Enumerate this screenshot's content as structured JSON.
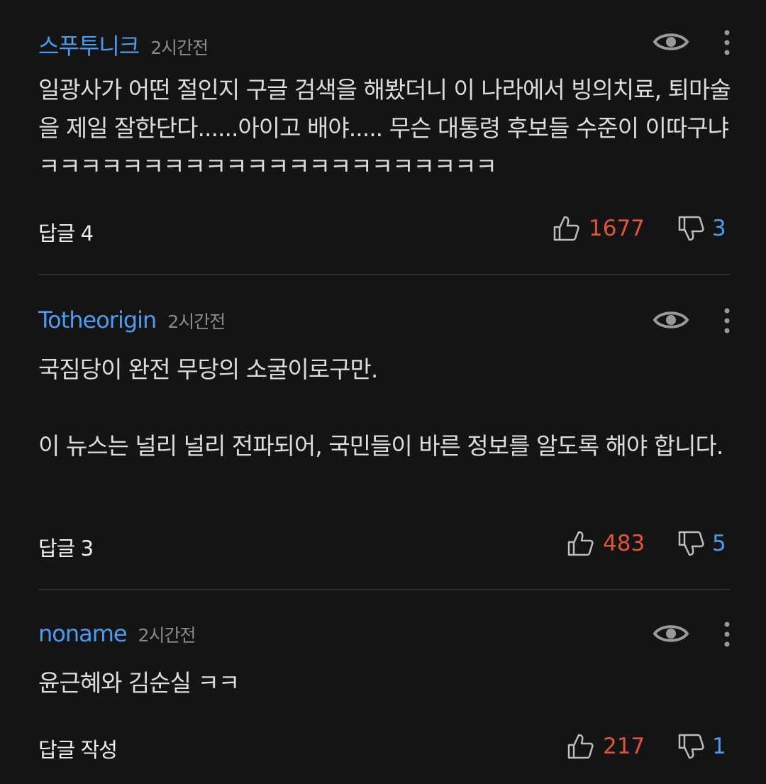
{
  "comments": [
    {
      "username": "스푸투니크",
      "time": "2시간전",
      "text": "일광사가 어떤 절인지 구글 검색을 해봤더니 이 나라에서 빙의치료, 퇴마술을 제일 잘한단다......아이고 배야..... 무슨 대통령 후보들 수준이 이따구냐 ㅋㅋㅋㅋㅋㅋㅋㅋㅋㅋㅋㅋㅋㅋㅋㅋㅋㅋㅋㅋㅋㅋ",
      "replies": "답글 4",
      "likes": "1677",
      "dislikes": "3"
    },
    {
      "username": "Totheorigin",
      "time": "2시간전",
      "text": "국짐당이 완전 무당의 소굴이로구만.\n\n이 뉴스는 널리 널리 전파되어, 국민들이 바른 정보를 알도록 해야 합니다.",
      "replies": "답글 3",
      "likes": "483",
      "dislikes": "5"
    },
    {
      "username": "noname",
      "time": "2시간전",
      "text": "윤근혜와 김순실 ㅋㅋ",
      "replies": "답글 작성",
      "likes": "217",
      "dislikes": "1"
    }
  ],
  "icons": {
    "view": "eye-icon",
    "more": "more-vertical-icon",
    "like": "thumbs-up-icon",
    "dislike": "thumbs-down-icon"
  },
  "colors": {
    "username": "#4d9bf0",
    "likes": "#e0533c",
    "dislikes": "#4d9bf0",
    "background": "#141414"
  }
}
